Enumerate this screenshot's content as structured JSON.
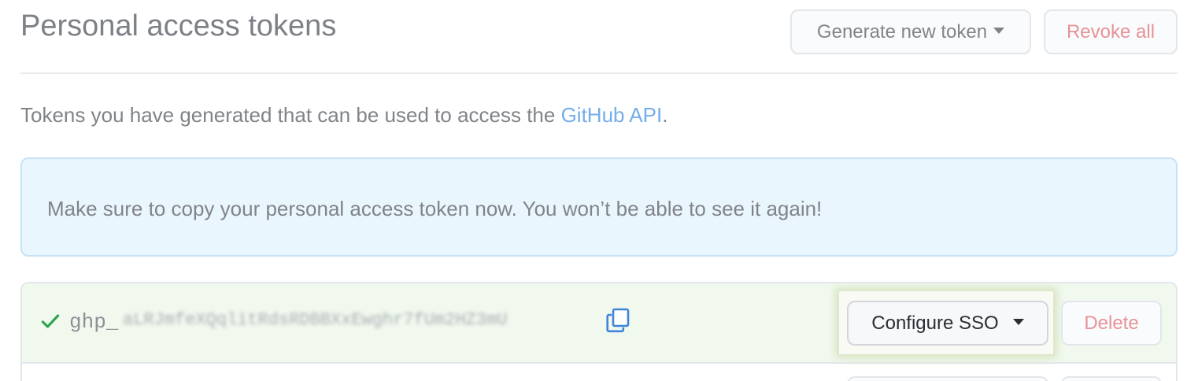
{
  "header": {
    "title": "Personal access tokens",
    "generate_label": "Generate new token",
    "revoke_label": "Revoke all"
  },
  "description": {
    "text": "Tokens you have generated that can be used to access the ",
    "link": "GitHub API",
    "suffix": "."
  },
  "flash": {
    "message": "Make sure to copy your personal access token now. You won’t be able to see it again!"
  },
  "tokens": [
    {
      "prefix": "ghp_",
      "secret": "aLRJmfeXQqlitRdsRDBBXxEwghr7fUm2HZ3mU",
      "configure_label": "Configure SSO",
      "delete_label": "Delete"
    }
  ],
  "colors": {
    "link": "#74aee9",
    "danger": "#e79296",
    "success": "#2ea44f",
    "flash_bg": "#eaf6fe",
    "row_bg": "#f1f9ef"
  },
  "icons": {
    "check": "check-icon",
    "copy": "copy-icon",
    "caret": "caret-down-icon"
  }
}
